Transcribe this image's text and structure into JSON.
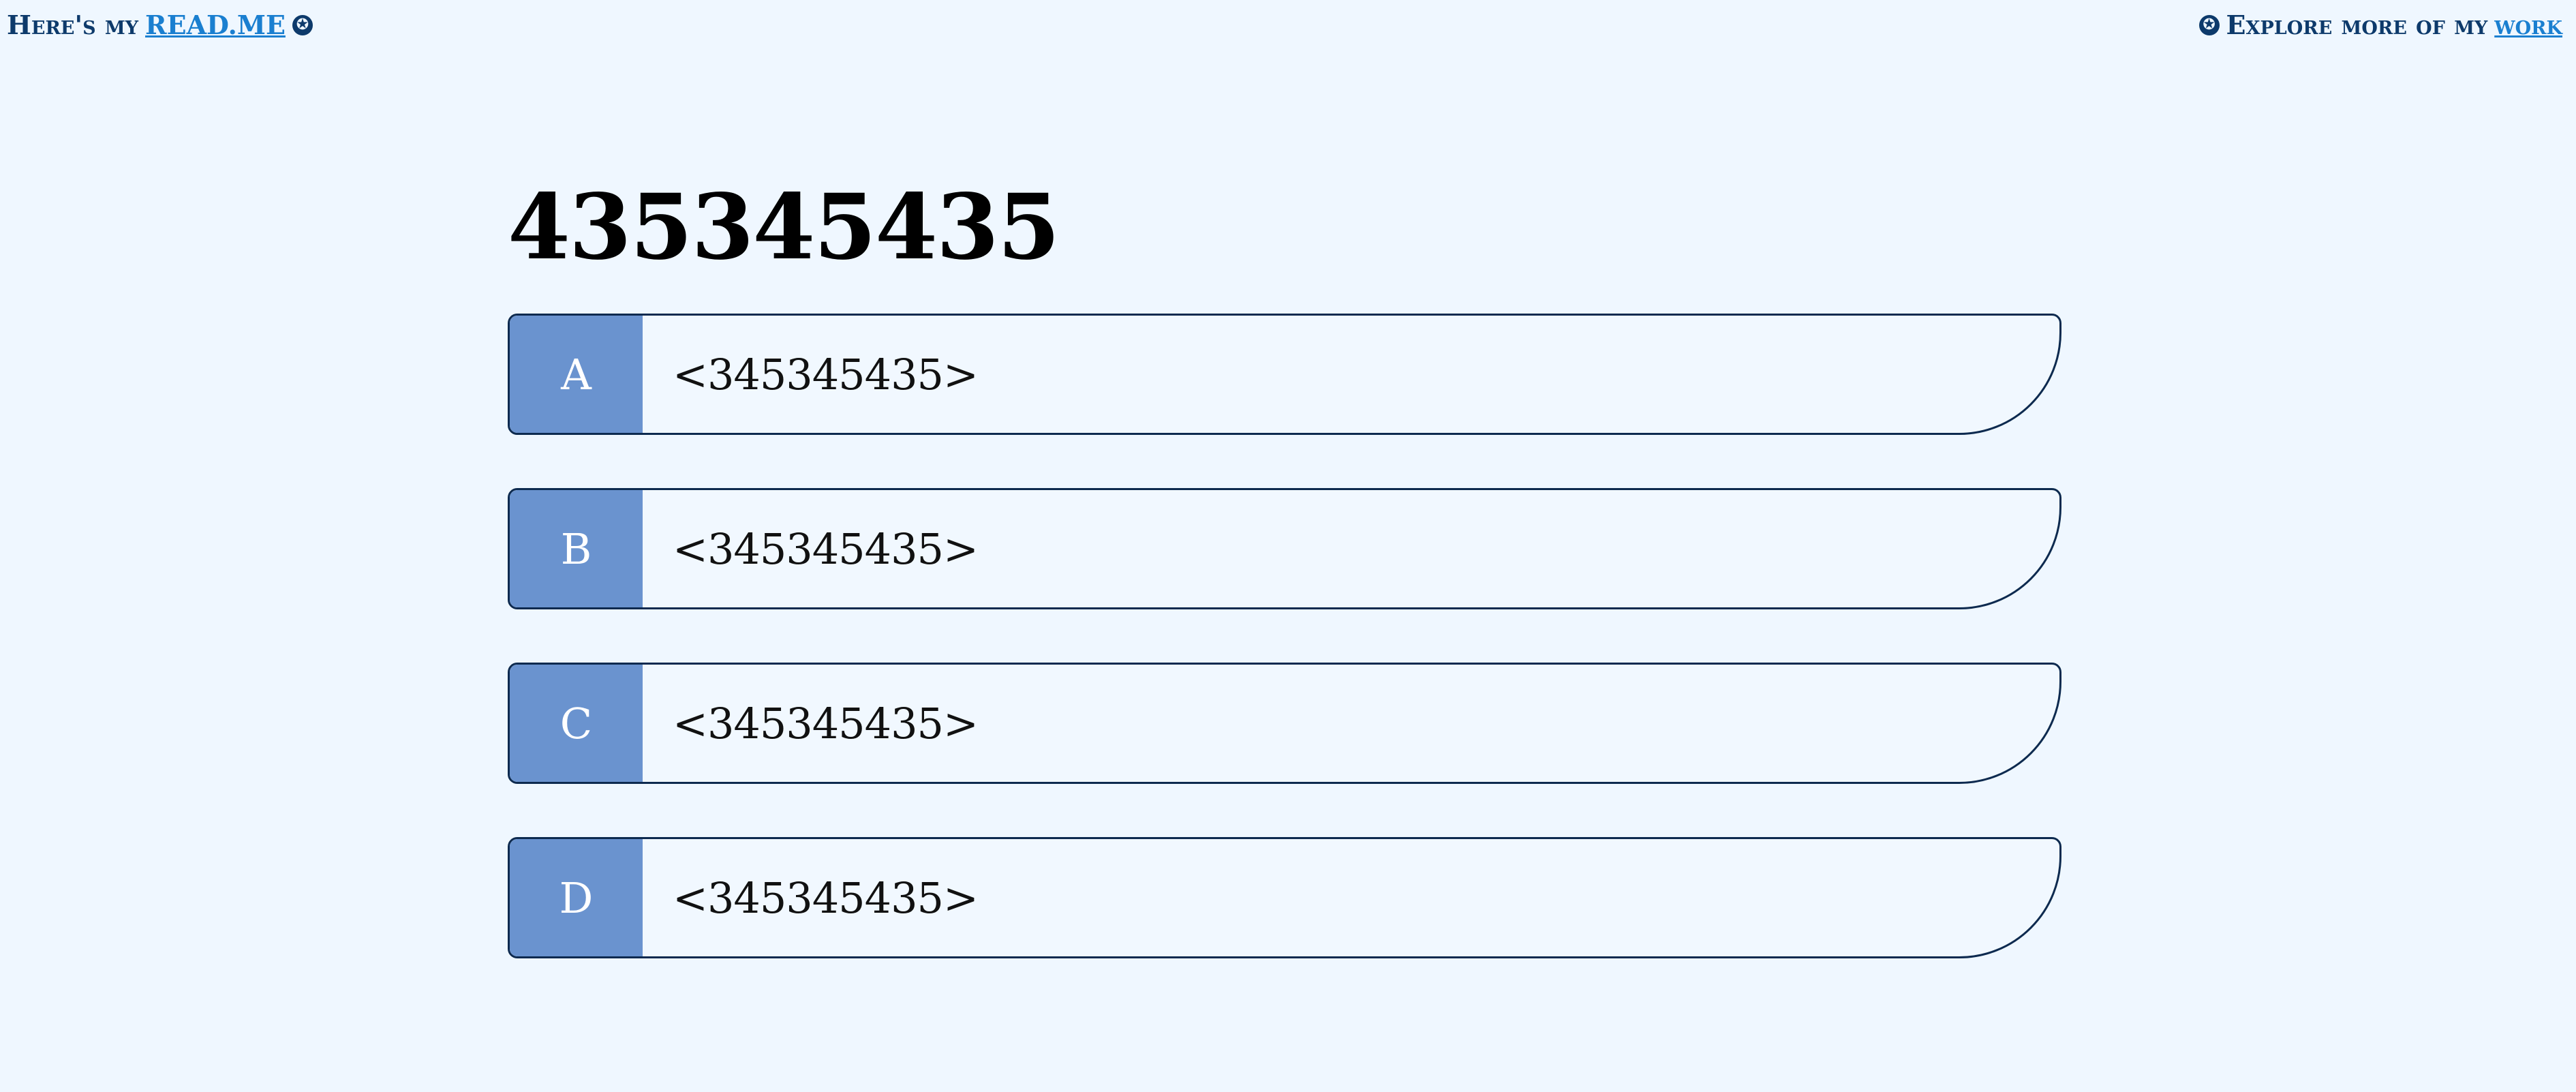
{
  "nav": {
    "left_prefix": "Here's my",
    "left_link": "READ.ME",
    "left_icon": "✪",
    "right_icon": "✪",
    "right_prefix": "Explore more of my",
    "right_link": "work"
  },
  "question": {
    "title": "435345435"
  },
  "answers": [
    {
      "letter": "A",
      "text": "<345345435>"
    },
    {
      "letter": "B",
      "text": "<345345435>"
    },
    {
      "letter": "C",
      "text": "<345345435>"
    },
    {
      "letter": "D",
      "text": "<345345435>"
    }
  ],
  "colors": {
    "background": "#eff7ff",
    "accent": "#6a93cf",
    "border": "#0d2a4f",
    "link": "#1a7fd0",
    "nav_text": "#0d3a6b"
  }
}
